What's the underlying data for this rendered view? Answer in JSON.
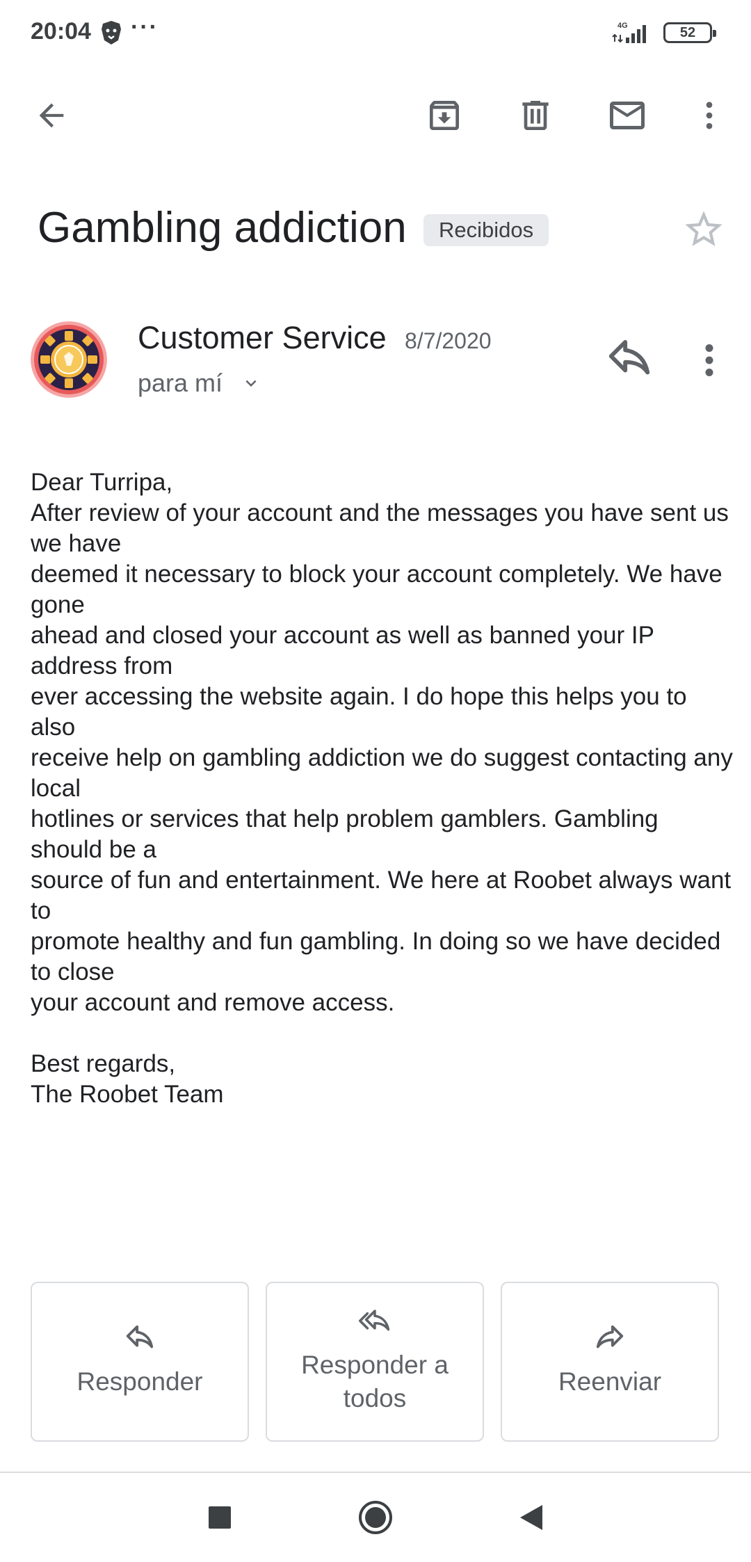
{
  "status": {
    "time": "20:04",
    "network": "4G",
    "battery": "52"
  },
  "toolbar": {
    "back_icon": "arrow-back-icon",
    "archive_icon": "archive-icon",
    "delete_icon": "trash-icon",
    "mark_unread_icon": "mail-icon",
    "more_icon": "more-vert-icon"
  },
  "email": {
    "subject": "Gambling addiction",
    "label": "Recibidos",
    "sender": "Customer Service",
    "date": "8/7/2020",
    "recipient": "para mí",
    "body_lines": [
      "Dear Turripa,",
      "After review of your account and the messages you have sent us we have",
      "deemed it necessary to block your account completely. We have gone",
      "ahead and closed your account as well as banned your IP address from",
      "ever accessing the website again. I do hope this helps you to also",
      "receive help on gambling addiction we do suggest contacting any local",
      "hotlines or services that help problem gamblers. Gambling should be a",
      "source of fun and entertainment. We here at Roobet always want to",
      "promote healthy and fun gambling. In doing so we have decided to close",
      "your account and remove access."
    ],
    "signoff_lines": [
      "Best regards,",
      "The Roobet Team"
    ]
  },
  "actions": {
    "reply": "Responder",
    "reply_all": "Responder a todos",
    "forward": "Reenviar"
  },
  "colors": {
    "icon": "#5f6368",
    "text": "#202124",
    "chip_bg": "#e8eaed",
    "border": "#dadce0"
  }
}
